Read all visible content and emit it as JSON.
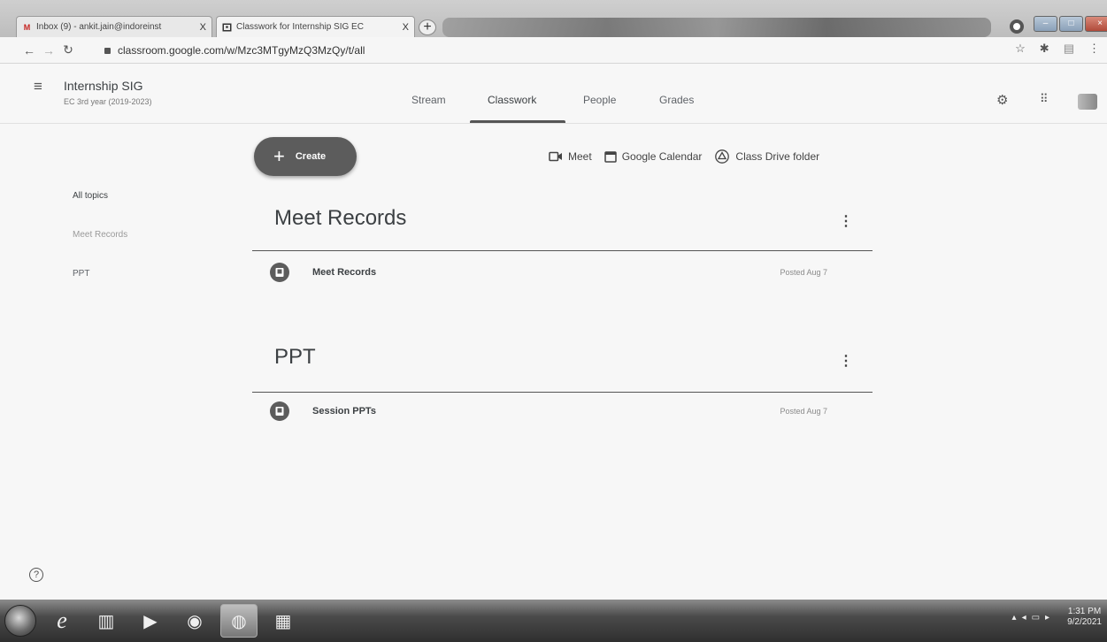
{
  "browser": {
    "tabs": [
      {
        "favicon": "gmail-icon",
        "title": "Inbox (9) - ankit.jain@indoreinst",
        "close": "X"
      },
      {
        "favicon": "classroom-icon",
        "title": "Classwork for Internship SIG EC",
        "close": "X"
      }
    ],
    "new_tab": "+",
    "url": "classroom.google.com/w/Mzc3MTgyMzQ3MzQy/t/all"
  },
  "app": {
    "class_name": "Internship SIG",
    "class_section": "EC 3rd year (2019-2023)",
    "tabs": [
      "Stream",
      "Classwork",
      "People",
      "Grades"
    ],
    "active_tab": "Classwork"
  },
  "toolbar": {
    "create_label": "Create",
    "links": [
      {
        "icon": "video-icon",
        "label": "Meet"
      },
      {
        "icon": "calendar-icon",
        "label": "Google Calendar"
      },
      {
        "icon": "drive-icon",
        "label": "Class Drive folder"
      }
    ]
  },
  "topics": [
    "All topics",
    "Meet Records",
    "PPT"
  ],
  "sections": [
    {
      "title": "Meet Records",
      "items": [
        {
          "title": "Meet Records",
          "posted": "Posted Aug 7",
          "icon": "material-icon"
        }
      ]
    },
    {
      "title": "PPT",
      "items": [
        {
          "title": "Session PPTs",
          "posted": "Posted Aug 7",
          "icon": "material-icon"
        }
      ]
    }
  ],
  "help": "?",
  "taskbar": {
    "time": "1:31 PM",
    "date": "9/2/2021"
  },
  "colors": {
    "accent": "#5c5c5c",
    "text": "#3c4043",
    "background": "#f7f7f7"
  }
}
